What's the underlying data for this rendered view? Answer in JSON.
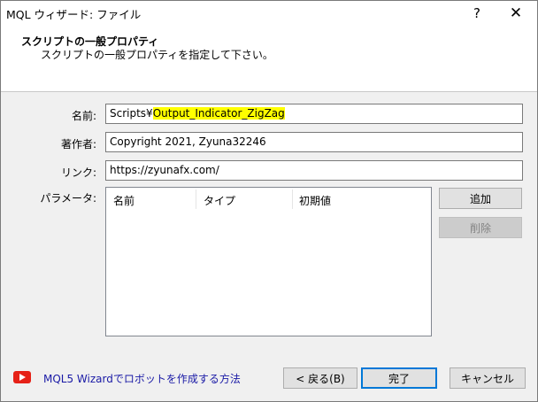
{
  "window": {
    "title": "MQL ウィザード: ファイル",
    "help_label": "?",
    "close_label": "✕"
  },
  "header": {
    "title": "スクリプトの一般プロパティ",
    "subtitle": "スクリプトの一般プロパティを指定して下さい。"
  },
  "form": {
    "name_label": "名前:",
    "name_prefix": "Scripts¥",
    "name_value": "Output_Indicator_ZigZag",
    "author_label": "著作者:",
    "author_value": "Copyright 2021, Zyuna32246",
    "link_label": "リンク:",
    "link_value": "https://zyunafx.com/",
    "params_label": "パラメータ:"
  },
  "params_table": {
    "columns": [
      "名前",
      "タイプ",
      "初期値"
    ],
    "rows": []
  },
  "side_buttons": {
    "add_label": "追加",
    "delete_label": "削除"
  },
  "footer": {
    "link_text": "MQL5 Wizardでロボットを作成する方法",
    "back_label": "< 戻る(B)",
    "finish_label": "完了",
    "cancel_label": "キャンセル"
  },
  "colors": {
    "highlight": "#ffff00",
    "default_button_border": "#0078d7",
    "link": "#1a1aa6",
    "youtube_red": "#e62117"
  }
}
